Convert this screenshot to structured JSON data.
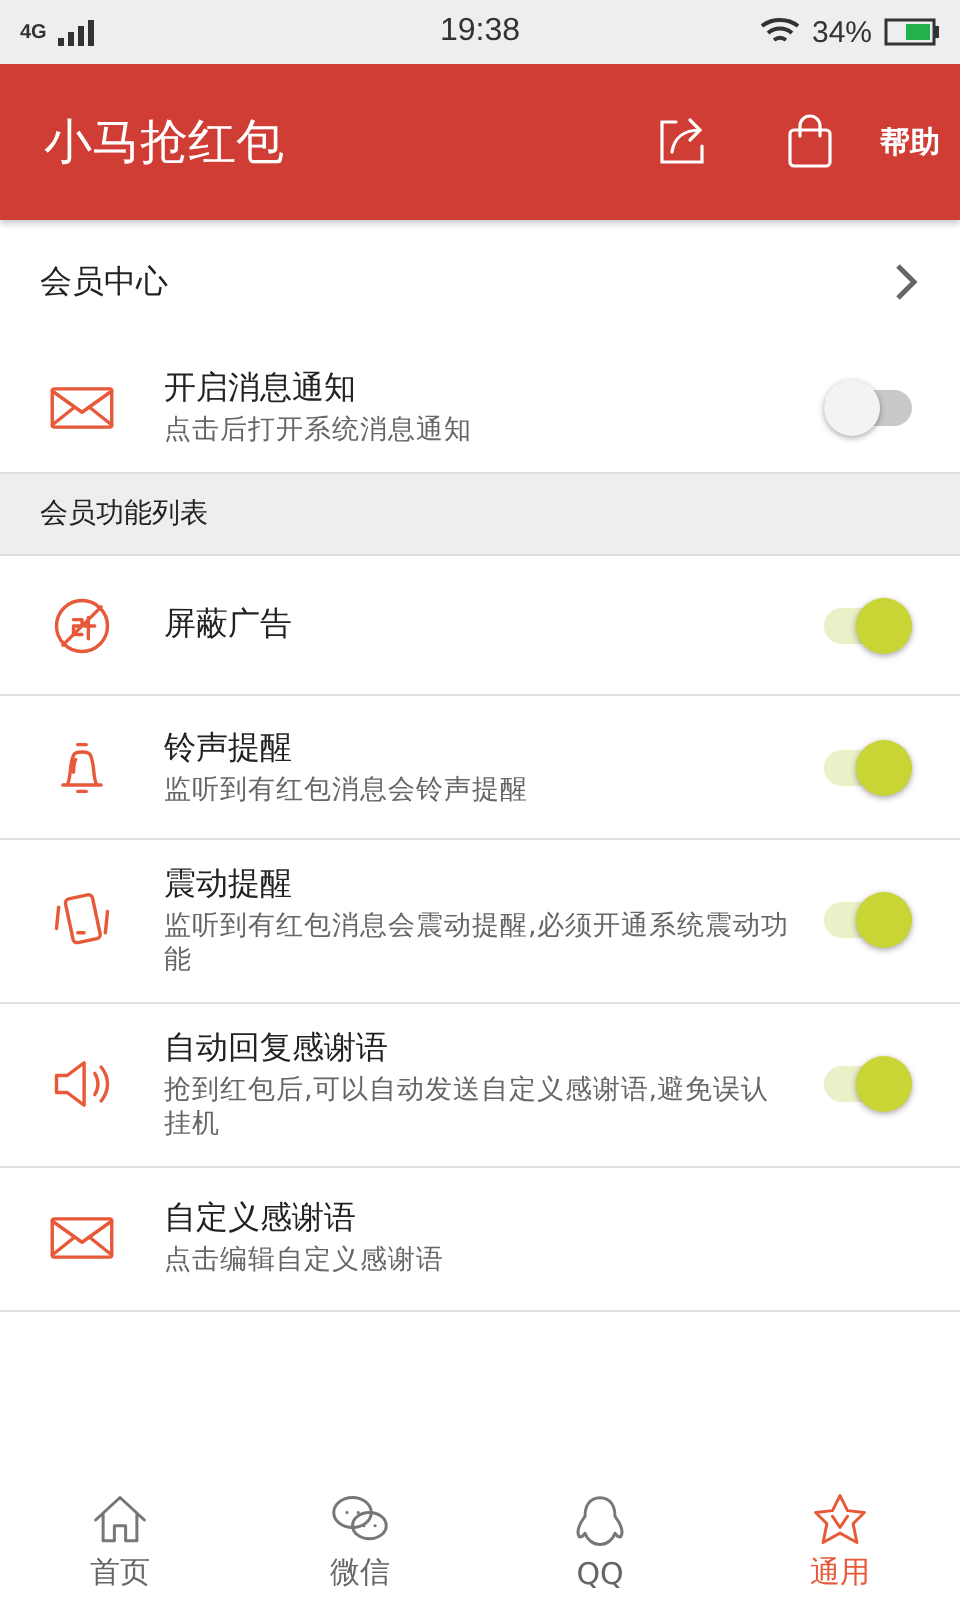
{
  "status_bar": {
    "network": "4G",
    "time": "19:38",
    "battery": "34%"
  },
  "header": {
    "title": "小马抢红包",
    "help": "帮助"
  },
  "member_center": {
    "label": "会员中心"
  },
  "notification": {
    "title": "开启消息通知",
    "subtitle": "点击后打开系统消息通知",
    "on": false
  },
  "section_title": "会员功能列表",
  "features": [
    {
      "kind": "toggle",
      "title": "屏蔽广告",
      "on": true
    },
    {
      "kind": "toggle",
      "title": "铃声提醒",
      "subtitle": "监听到有红包消息会铃声提醒",
      "on": true
    },
    {
      "kind": "toggle",
      "title": "震动提醒",
      "subtitle": "监听到有红包消息会震动提醒,必须开通系统震动功能",
      "on": true
    },
    {
      "kind": "toggle",
      "title": "自动回复感谢语",
      "subtitle": "抢到红包后,可以自动发送自定义感谢语,避免误认挂机",
      "on": true
    },
    {
      "kind": "link",
      "title": "自定义感谢语",
      "subtitle": "点击编辑自定义感谢语"
    }
  ],
  "tabs": [
    {
      "label": "首页",
      "selected": false
    },
    {
      "label": "微信",
      "selected": false
    },
    {
      "label": "QQ",
      "selected": false
    },
    {
      "label": "通用",
      "selected": true
    }
  ]
}
